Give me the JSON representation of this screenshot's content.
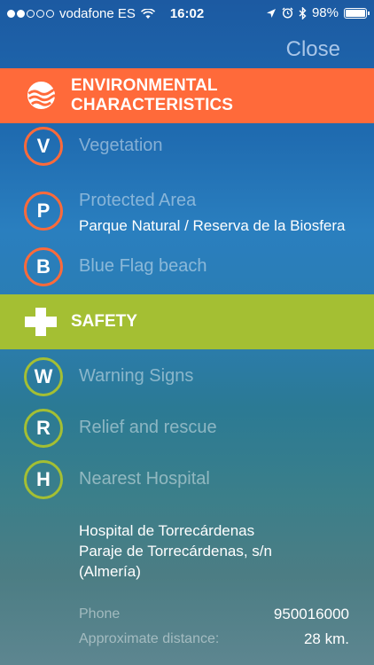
{
  "status_bar": {
    "carrier": "vodafone ES",
    "time": "16:02",
    "battery": "98%",
    "battery_level": 0.98,
    "signal_dots_filled": 2,
    "signal_dots_total": 5
  },
  "close_label": "Close",
  "environmental": {
    "title": "ENVIRONMENTAL CHARACTERISTICS",
    "color": "#ff6a3a",
    "items": [
      {
        "letter": "V",
        "label": "Vegetation"
      },
      {
        "letter": "P",
        "label": "Protected Area",
        "value": "Parque Natural / Reserva de la Biosfera"
      },
      {
        "letter": "B",
        "label": "Blue Flag beach"
      }
    ]
  },
  "safety": {
    "title": "SAFETY",
    "color": "#a4bf33",
    "items": [
      {
        "letter": "W",
        "label": "Warning Signs"
      },
      {
        "letter": "R",
        "label": "Relief and rescue"
      },
      {
        "letter": "H",
        "label": "Nearest Hospital"
      }
    ],
    "hospital": {
      "line1": "Hospital de Torrecárdenas",
      "line2": "Paraje de Torrecárdenas, s/n",
      "line3": "(Almería)"
    },
    "phone_label": "Phone",
    "phone_value": "950016000",
    "distance_label": "Approximate distance:",
    "distance_value": "28 km."
  }
}
